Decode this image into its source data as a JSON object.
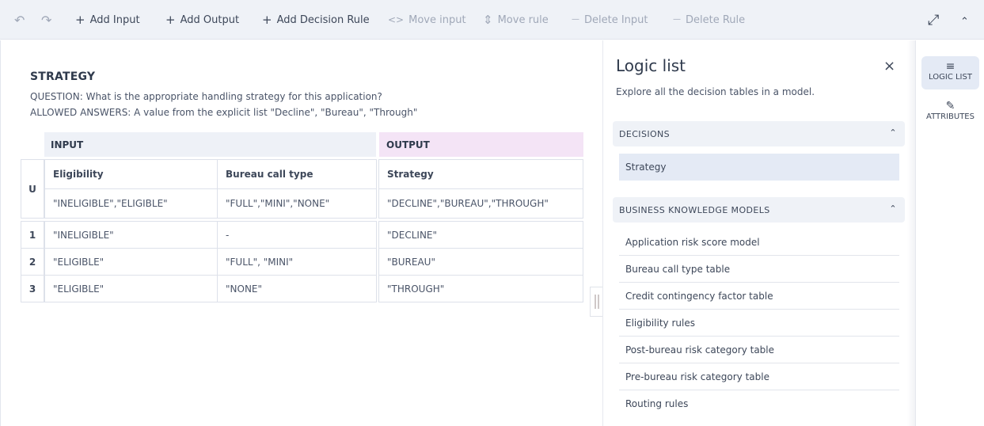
{
  "toolbar": {
    "undo_icon": "↶",
    "redo_icon": "↷",
    "add_input": {
      "icon": "+",
      "label": "Add Input"
    },
    "add_output": {
      "icon": "+",
      "label": "Add Output"
    },
    "add_rule": {
      "icon": "+",
      "label": "Add Decision Rule"
    },
    "move_input": {
      "icon": "<>",
      "label": "Move input"
    },
    "move_rule": {
      "icon": "⇕",
      "label": "Move rule"
    },
    "delete_input": {
      "icon": "—",
      "label": "Delete Input"
    },
    "delete_rule": {
      "icon": "—",
      "label": "Delete Rule"
    },
    "expand_icon": "⤢",
    "collapse_icon": "⌃"
  },
  "table": {
    "title": "STRATEGY",
    "question": "QUESTION: What is the appropriate handling strategy for this application?",
    "allowed_answers": "ALLOWED ANSWERS: A value from the explicit list \"Decline\", \"Bureau\", \"Through\"",
    "input_group": "INPUT",
    "output_group": "OUTPUT",
    "hit_policy": "U",
    "columns": [
      {
        "name": "Eligibility",
        "allowed": "\"INELIGIBLE\",\"ELIGIBLE\""
      },
      {
        "name": "Bureau call type",
        "allowed": "\"FULL\",\"MINI\",\"NONE\""
      },
      {
        "name": "Strategy",
        "allowed": "\"DECLINE\",\"BUREAU\",\"THROUGH\""
      }
    ],
    "rules": [
      {
        "num": "1",
        "cells": [
          "\"INELIGIBLE\"",
          "-",
          "\"DECLINE\""
        ]
      },
      {
        "num": "2",
        "cells": [
          "\"ELIGIBLE\"",
          "\"FULL\", \"MINI\"",
          "\"BUREAU\""
        ]
      },
      {
        "num": "3",
        "cells": [
          "\"ELIGIBLE\"",
          "\"NONE\"",
          "\"THROUGH\""
        ]
      }
    ]
  },
  "panel": {
    "title": "Logic list",
    "close_icon": "×",
    "description": "Explore all the decision tables in a model.",
    "decisions_header": "DECISIONS",
    "decisions": [
      "Strategy"
    ],
    "bkm_header": "BUSINESS KNOWLEDGE MODELS",
    "bkm": [
      "Application risk score model",
      "Bureau call type table",
      "Credit contingency factor table",
      "Eligibility rules",
      "Post-bureau risk category table",
      "Pre-bureau risk category table",
      "Routing rules"
    ],
    "chevron_icon": "⌃"
  },
  "rail": {
    "logic_list": {
      "icon": "≡",
      "label": "LOGIC LIST"
    },
    "attributes": {
      "icon": "✎",
      "label": "ATTRIBUTES"
    }
  },
  "colors": {
    "toolbar_bg": "#eff2f7",
    "output_header": "#f4e4f6",
    "input_header": "#eef1f7",
    "selected_item": "#e4eaf5"
  }
}
